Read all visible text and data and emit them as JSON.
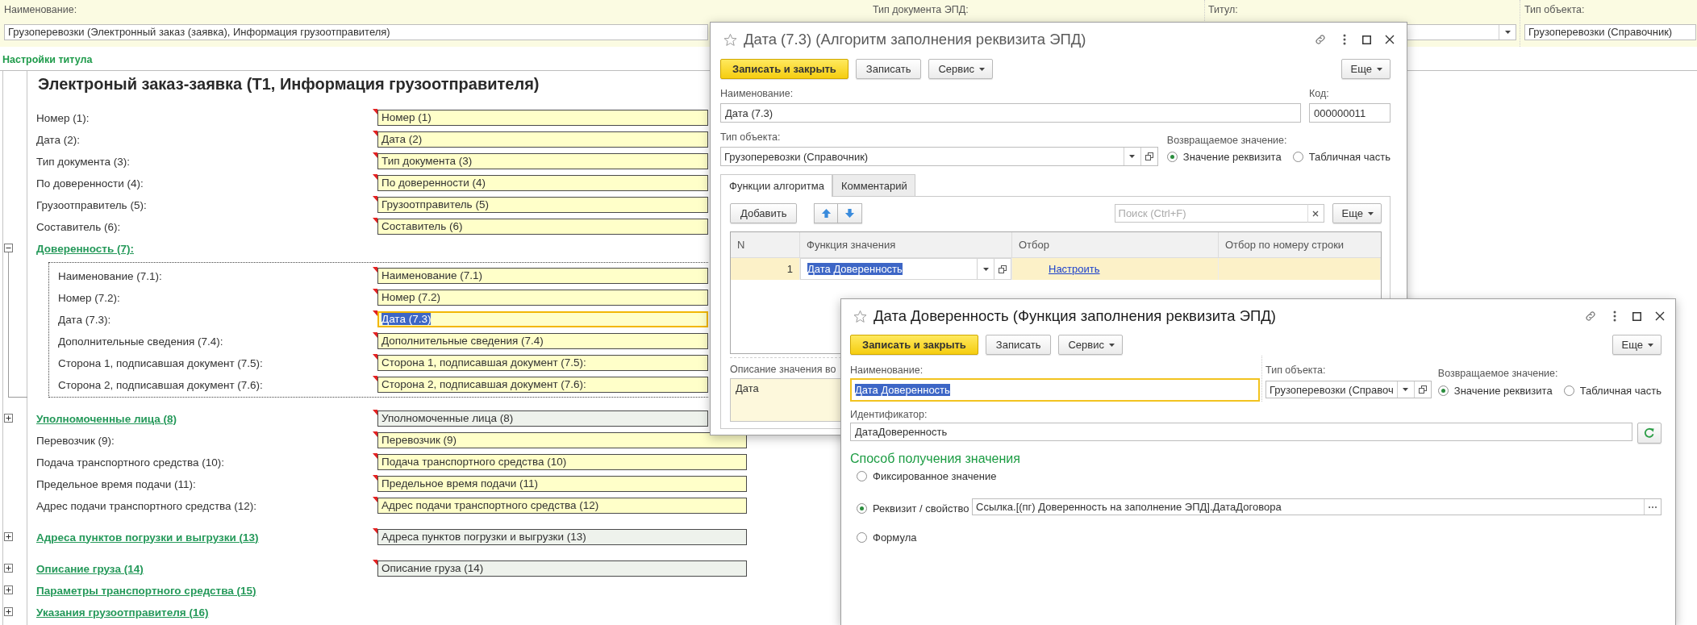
{
  "header": {
    "name_field": {
      "label": "Наименование:",
      "value": "Грузоперевозки (Электронный заказ (заявка), Информация грузоотправителя)"
    },
    "doc_type_field": {
      "label": "Тип документа ЭПД:"
    },
    "title_field": {
      "label": "Титул:"
    },
    "object_type_field": {
      "label": "Тип объекта:",
      "value": "Грузоперевозки (Справочник)"
    }
  },
  "section_title": "Настройки титула",
  "form": {
    "title": "Электроный заказ-заявка (Т1, Информация грузоотправителя)",
    "rows": [
      {
        "kind": "field",
        "label": "Номер (1):",
        "value": "Номер (1)",
        "focused": false
      },
      {
        "kind": "field",
        "label": "Дата (2):",
        "value": "Дата (2)",
        "focused": false
      },
      {
        "kind": "field",
        "label": "Тип документа (3):",
        "value": "Тип документа (3)",
        "focused": false
      },
      {
        "kind": "field",
        "label": "По доверенности (4):",
        "value": "По доверенности (4)",
        "focused": false
      },
      {
        "kind": "field",
        "label": "Грузоотправитель (5):",
        "value": "Грузоотправитель (5)",
        "focused": false
      },
      {
        "kind": "field",
        "label": "Составитель (6):",
        "value": "Составитель (6)",
        "focused": false
      },
      {
        "kind": "group",
        "label": "Доверенность (7):",
        "expanded": true,
        "children": [
          {
            "kind": "field",
            "label": "Наименование (7.1):",
            "value": "Наименование (7.1)",
            "focused": false
          },
          {
            "kind": "field",
            "label": "Номер (7.2):",
            "value": "Номер (7.2)",
            "focused": false
          },
          {
            "kind": "field",
            "label": "Дата (7.3):",
            "value": "Дата (7.3)",
            "focused": true
          },
          {
            "kind": "field",
            "label": "Дополнительные сведения (7.4):",
            "value": "Дополнительные сведения (7.4)",
            "focused": false
          },
          {
            "kind": "field",
            "label": "Сторона 1, подписавшая документ (7.5):",
            "value": "Сторона 1, подписавшая документ (7.5):",
            "focused": false
          },
          {
            "kind": "field",
            "label": "Сторона 2, подписавшая документ (7.6):",
            "value": "Сторона 2, подписавшая документ (7.6):",
            "focused": false
          }
        ]
      },
      {
        "kind": "group",
        "label": "Уполномоченные лица (8)",
        "expanded": false,
        "value": "Уполномоченные лица (8)"
      },
      {
        "kind": "field",
        "label": "Перевозчик (9):",
        "value": "Перевозчик (9)",
        "focused": false
      },
      {
        "kind": "field",
        "label": "Подача транспортного средства (10):",
        "value": "Подача транспортного средства (10)",
        "focused": false
      },
      {
        "kind": "field",
        "label": "Предельное время подачи (11):",
        "value": "Предельное время подачи (11)",
        "focused": false
      },
      {
        "kind": "field",
        "label": "Адрес подачи транспортного средства (12):",
        "value": "Адрес подачи транспортного средства (12)",
        "focused": false
      },
      {
        "kind": "group",
        "label": "Адреса пунктов погрузки и выгрузки (13)",
        "expanded": false,
        "value": "Адреса пунктов погрузки и выгрузки (13)"
      },
      {
        "kind": "group",
        "label": "Описание груза (14)",
        "expanded": false,
        "value": "Описание груза (14)"
      },
      {
        "kind": "group",
        "label": "Параметры транспортного средства (15)",
        "expanded": false
      },
      {
        "kind": "group",
        "label": "Указания грузоотправителя (16)",
        "expanded": false
      }
    ]
  },
  "algorithm_window": {
    "active": false,
    "title": "Дата (7.3) (Алгоритм заполнения реквизита ЭПД)",
    "buttons": [
      {
        "kind": "primary",
        "label": "Записать и закрыть"
      },
      {
        "kind": "plain",
        "label": "Записать"
      },
      {
        "kind": "menu",
        "label": "Сервис"
      }
    ],
    "more_button": "Еще",
    "name_field": {
      "label": "Наименование:",
      "value": "Дата (7.3)"
    },
    "code_field": {
      "label": "Код:",
      "value": "000000011"
    },
    "object_type_field": {
      "label": "Тип объекта:",
      "value": "Грузоперевозки (Справочник)"
    },
    "return_value": {
      "label": "Возвращаемое значение:",
      "options": [
        {
          "label": "Значение реквизита",
          "selected": true
        },
        {
          "label": "Табличная часть",
          "selected": false
        }
      ]
    },
    "tabs": [
      {
        "label": "Функции алгоритма",
        "selected": true
      },
      {
        "label": "Комментарий",
        "selected": false
      }
    ],
    "toolbar": {
      "add_button": "Добавить",
      "search": {
        "placeholder": "Поиск (Ctrl+F)"
      },
      "more_button": "Еще"
    },
    "table": {
      "columns": [
        "N",
        "Функция значения",
        "Отбор",
        "Отбор по номеру строки"
      ],
      "rows": [
        {
          "number": "1",
          "function": "Дата Доверенность",
          "filter_link": "Настроить",
          "selected": true
        }
      ]
    },
    "description": {
      "label": "Описание значения во",
      "value": "Дата"
    }
  },
  "function_window": {
    "active": true,
    "title": "Дата Доверенность (Функция заполнения реквизита ЭПД)",
    "buttons": [
      {
        "kind": "primary",
        "label": "Записать и закрыть"
      },
      {
        "kind": "plain",
        "label": "Записать"
      },
      {
        "kind": "menu",
        "label": "Сервис"
      }
    ],
    "more_button": "Еще",
    "name_field": {
      "label": "Наименование:",
      "value": "Дата Доверенность",
      "focused": true
    },
    "object_type_field": {
      "label": "Тип объекта:",
      "value": "Грузоперевозки (Справоч"
    },
    "return_value": {
      "label": "Возвращаемое значение:",
      "options": [
        {
          "label": "Значение реквизита",
          "selected": true
        },
        {
          "label": "Табличная часть",
          "selected": false
        }
      ]
    },
    "identifier_field": {
      "label": "Идентификатор:",
      "value": "ДатаДоверенность"
    },
    "method": {
      "title": "Способ получения значения",
      "options": [
        {
          "kind": "plain",
          "label": "Фиксированное значение",
          "selected": false
        },
        {
          "kind": "attribute",
          "label": "Реквизит / свойство",
          "selected": true,
          "value": "Ссылка.[(пг) Доверенность на заполнение ЭПД].ДатаДоговора"
        },
        {
          "kind": "plain",
          "label": "Формула",
          "selected": false
        }
      ]
    }
  }
}
